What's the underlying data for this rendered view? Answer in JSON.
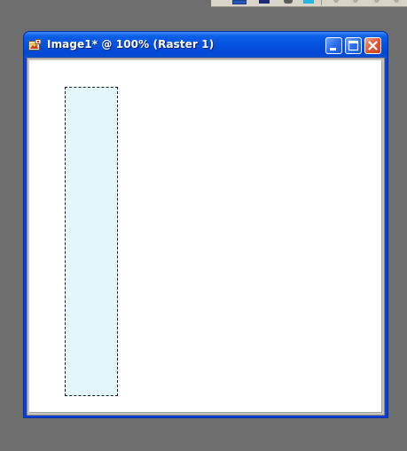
{
  "window": {
    "title": "Image1* @ 100% (Raster 1)",
    "icon": "image-document-icon",
    "buttons": {
      "minimize": "minimize-icon",
      "maximize": "maximize-icon",
      "close": "close-icon"
    }
  },
  "canvas": {
    "layer": "Raster 1",
    "zoom": "100%",
    "selection": {
      "style": "marching-ants",
      "fill_color": "#e2f6fc"
    }
  },
  "colors": {
    "workspace": "#6e6e6e",
    "titlebar": "#0553e0",
    "close_button": "#e05a36"
  }
}
